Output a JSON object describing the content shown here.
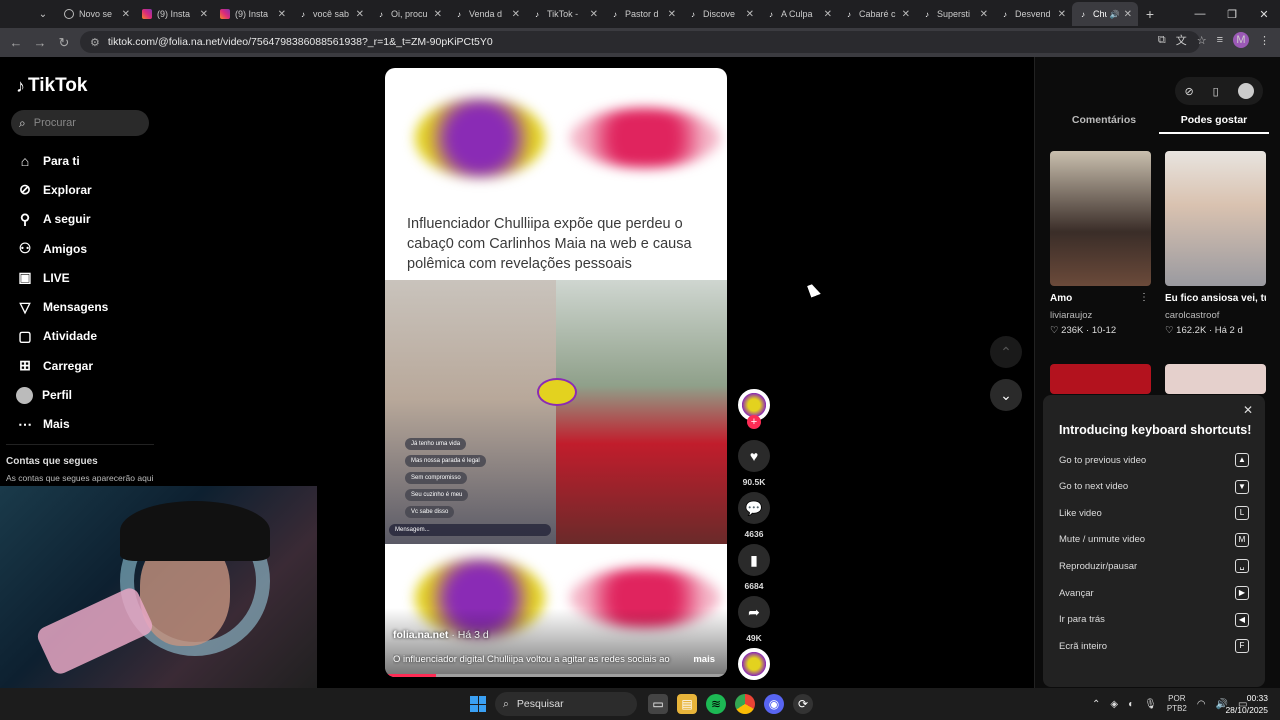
{
  "browser": {
    "tabs": [
      {
        "title": "Novo se",
        "icon": "chrome-newtab-icon"
      },
      {
        "title": "(9) Insta",
        "icon": "instagram-icon"
      },
      {
        "title": "(9) Insta",
        "icon": "instagram-icon"
      },
      {
        "title": "você sab",
        "icon": "tiktok-icon"
      },
      {
        "title": "Oi, procu",
        "icon": "tiktok-icon"
      },
      {
        "title": "Venda d",
        "icon": "tiktok-icon"
      },
      {
        "title": "TikTok -",
        "icon": "tiktok-icon"
      },
      {
        "title": "Pastor d",
        "icon": "tiktok-icon"
      },
      {
        "title": "Discove",
        "icon": "tiktok-icon"
      },
      {
        "title": "A Culpa",
        "icon": "tiktok-icon"
      },
      {
        "title": "Cabaré c",
        "icon": "tiktok-icon"
      },
      {
        "title": "Supersti",
        "icon": "tiktok-icon"
      },
      {
        "title": "Desvend",
        "icon": "tiktok-icon"
      },
      {
        "title": "Chul",
        "icon": "tiktok-icon",
        "active": true
      }
    ],
    "url": "tiktok.com/@folia.na.net/video/7564798386088561938?_r=1&_t=ZM-90pKiPCt5Y0",
    "profile_initial": "M"
  },
  "sidebar": {
    "logo": "TikTok",
    "search_placeholder": "Procurar",
    "items": [
      {
        "label": "Para ti",
        "icon": "home-icon"
      },
      {
        "label": "Explorar",
        "icon": "compass-icon"
      },
      {
        "label": "A seguir",
        "icon": "following-icon"
      },
      {
        "label": "Amigos",
        "icon": "friends-icon"
      },
      {
        "label": "LIVE",
        "icon": "live-icon"
      },
      {
        "label": "Mensagens",
        "icon": "messages-icon"
      },
      {
        "label": "Atividade",
        "icon": "activity-icon"
      },
      {
        "label": "Carregar",
        "icon": "upload-icon"
      },
      {
        "label": "Perfil",
        "icon": "avatar"
      },
      {
        "label": "Mais",
        "icon": "more-icon"
      }
    ],
    "following_title": "Contas que segues",
    "following_subtitle": "As contas que segues aparecerão aqui"
  },
  "video": {
    "headline": "Influenciador Chulliipa expõe que perdeu o cabaç0 com Carlinhos Maia na web e causa polêmica com revelações pessoais",
    "chat_lines": [
      "Já tenho uma vida",
      "Mas nossa parada é legal",
      "Sem compromisso",
      "Seu cuzinho é meu",
      "Vc sabe disso"
    ],
    "chat_placeholder": "Mensagem...",
    "author": "folia.na.net",
    "posted": "· Há 3 d",
    "description": "O influenciador digital Chulliipa voltou a agitar as redes sociais ao",
    "more_label": "mais",
    "progress": 0.15
  },
  "actions": {
    "likes": "90.5K",
    "comments": "4636",
    "saves": "6684",
    "shares": "49K"
  },
  "right_panel": {
    "tabs": [
      "Comentários",
      "Podes gostar"
    ],
    "active_tab": "Podes gostar",
    "cards": [
      {
        "title": "Amo",
        "author": "liviaraujoz",
        "likes": "236K",
        "date": "10-12",
        "has_menu": true
      },
      {
        "title": "Eu fico ansiosa vei, tudo pra acordar ...",
        "author": "carolcastroof",
        "likes": "162.2K",
        "date": "Há 2 d",
        "has_menu": false
      }
    ]
  },
  "shortcuts": {
    "title": "Introducing keyboard shortcuts!",
    "rows": [
      {
        "label": "Go to previous video",
        "key": "▲"
      },
      {
        "label": "Go to next video",
        "key": "▼"
      },
      {
        "label": "Like video",
        "key": "L"
      },
      {
        "label": "Mute / unmute video",
        "key": "M"
      },
      {
        "label": "Reproduzir/pausar",
        "key": "␣"
      },
      {
        "label": "Avançar",
        "key": "▶"
      },
      {
        "label": "Ir para trás",
        "key": "◀"
      },
      {
        "label": "Ecrã inteiro",
        "key": "F"
      }
    ]
  },
  "taskbar": {
    "search_label": "Pesquisar",
    "lang_top": "POR",
    "lang_bottom": "PTB2",
    "time": "00:33",
    "date": "28/10/2025"
  },
  "colors": {
    "accent": "#fe2c55",
    "brand_yellow": "#e3d21f",
    "brand_purple": "#8a2bb5"
  }
}
